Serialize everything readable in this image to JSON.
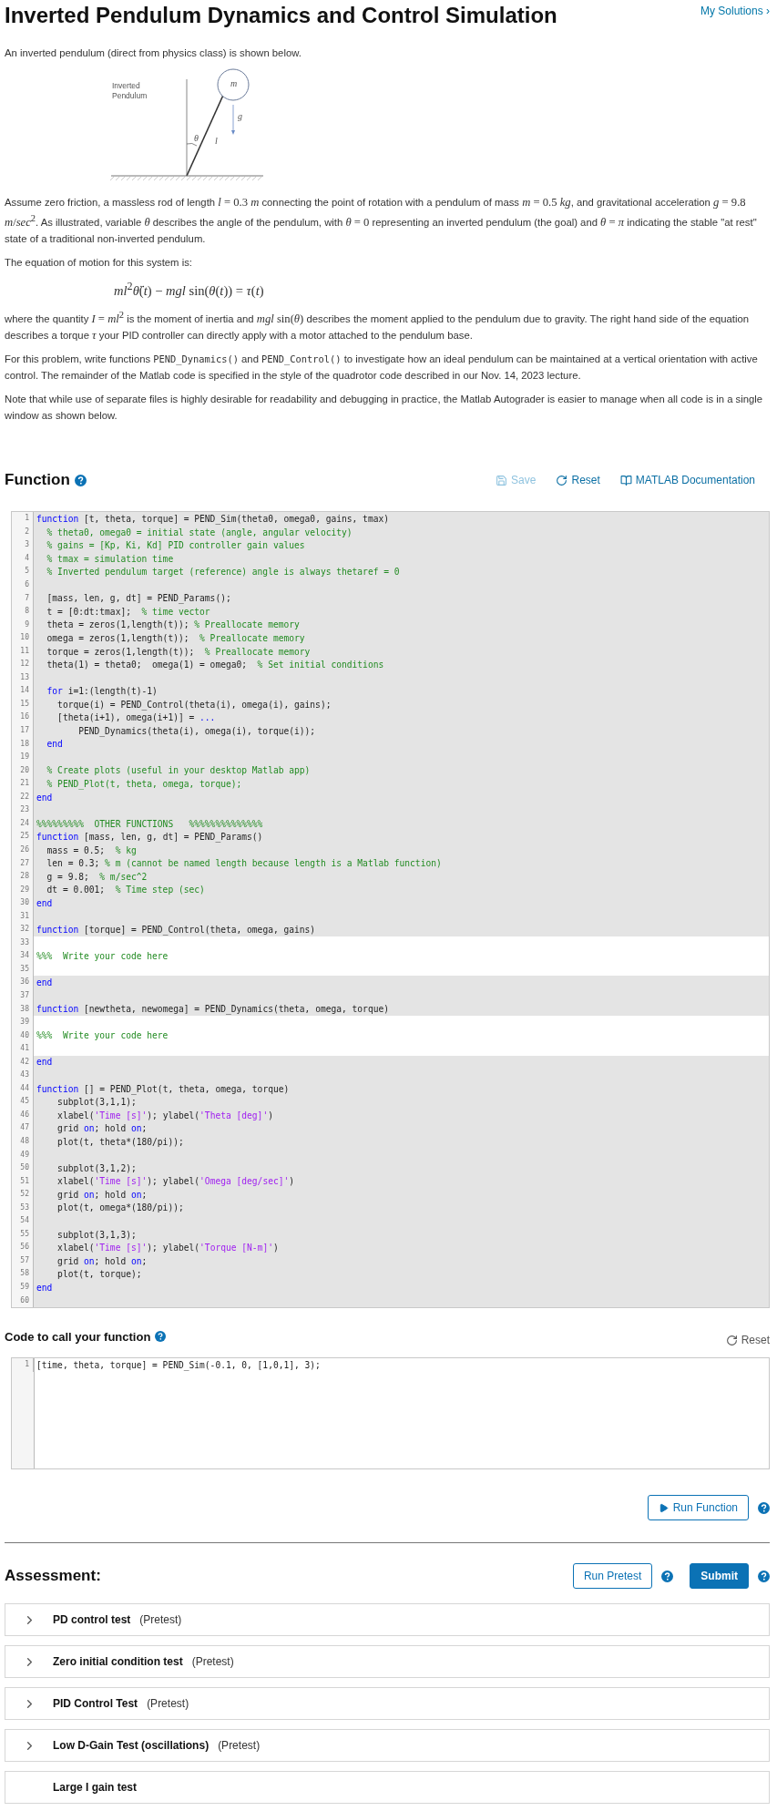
{
  "header": {
    "title": "Inverted Pendulum Dynamics and Control Simulation",
    "link": "My Solutions ›"
  },
  "intro": "An inverted pendulum (direct from physics class) is shown below.",
  "figure": {
    "labels": [
      {
        "kind": "caption",
        "text": "Inverted Pendulum"
      },
      {
        "kind": "mass",
        "text": "m"
      },
      {
        "kind": "gravity",
        "text": "g"
      },
      {
        "kind": "angle",
        "text": "θ"
      },
      {
        "kind": "length",
        "text": "l"
      }
    ]
  },
  "paragraphs": [
    {
      "kind": "text",
      "parts": [
        {
          "kind": "text",
          "text": "Assume zero friction, a massless rod of length "
        },
        {
          "kind": "math",
          "text": "*l* = 0.3  *m*"
        },
        {
          "kind": "text",
          "text": " connecting the point of rotation with a pendulum of mass "
        },
        {
          "kind": "math",
          "text": "*m* = 0.5  *kg*"
        },
        {
          "kind": "text",
          "text": ", and gravitational acceleration "
        },
        {
          "kind": "math",
          "text": "*g* = 9.8  *m*/*sec*$^{2}$"
        },
        {
          "kind": "text",
          "text": ".  As illustrated, variable "
        },
        {
          "kind": "math",
          "text": "*θ*"
        },
        {
          "kind": "text",
          "text": " describes the angle of the pendulum, with "
        },
        {
          "kind": "math",
          "text": "*θ* = 0"
        },
        {
          "kind": "text",
          "text": " representing an inverted pendulum (the goal) and "
        },
        {
          "kind": "math",
          "text": "*θ* = *π*"
        },
        {
          "kind": "text",
          "text": " indicating the stable \"at rest\" state of a traditional non-inverted pendulum."
        }
      ]
    },
    {
      "kind": "text",
      "parts": [
        {
          "kind": "text",
          "text": "The  equation of motion for this system is:"
        }
      ]
    },
    {
      "kind": "equation",
      "parts": [
        {
          "kind": "math",
          "text": "*ml*$^{2}$*θ̈*(*t*) − *mgl* sin(*θ*(*t*)) = *τ*(*t*)"
        }
      ]
    },
    {
      "kind": "text",
      "parts": [
        {
          "kind": "text",
          "text": "where the quantity "
        },
        {
          "kind": "math",
          "text": "*I* = *ml*$^{2}$"
        },
        {
          "kind": "text",
          "text": " is the moment of inertia and "
        },
        {
          "kind": "math",
          "text": "*mgl* sin(*θ*)"
        },
        {
          "kind": "text",
          "text": " describes the moment applied to the pendulum due to gravity.  The right hand side of the equation describes a torque "
        },
        {
          "kind": "math",
          "text": "*τ*"
        },
        {
          "kind": "text",
          "text": " your PID controller can directly apply with a motor attached to the pendulum base."
        }
      ]
    },
    {
      "kind": "text",
      "parts": [
        {
          "kind": "text",
          "text": "For this problem, write functions "
        },
        {
          "kind": "code",
          "text": "PEND_Dynamics()"
        },
        {
          "kind": "text",
          "text": " and "
        },
        {
          "kind": "code",
          "text": "PEND_Control()"
        },
        {
          "kind": "text",
          "text": " to investigate how an ideal pendulum can be maintained at a vertical orientation with active control.  The remainder of the Matlab code is specified in the style of the quadrotor code described in our Nov. 14, 2023 lecture."
        }
      ]
    },
    {
      "kind": "text",
      "parts": [
        {
          "kind": "text",
          "text": "Note that while use of separate files is highly desirable for readability and debugging in practice, the Matlab Autograder is easier to manage when all code is in a single window as shown below."
        }
      ]
    }
  ],
  "function_section": {
    "title": "Function",
    "actions": [
      {
        "kind": "save",
        "label": "Save",
        "disabled": true
      },
      {
        "kind": "reset",
        "label": "Reset",
        "disabled": false
      },
      {
        "kind": "docs",
        "label": "MATLAB Documentation",
        "disabled": false
      }
    ],
    "code": [
      {
        "number": "1",
        "editable": false,
        "segments": [
          {
            "kind": "keyword",
            "text": "function"
          },
          {
            "kind": "plain",
            "text": " [t, theta, torque] = PEND_Sim(theta0, omega0, gains, tmax)"
          }
        ]
      },
      {
        "number": "2",
        "editable": false,
        "segments": [
          {
            "kind": "comment",
            "text": "  % theta0, omega0 = initial state (angle, angular velocity)"
          }
        ]
      },
      {
        "number": "3",
        "editable": false,
        "segments": [
          {
            "kind": "comment",
            "text": "  % gains = [Kp, Ki, Kd] PID controller gain values"
          }
        ]
      },
      {
        "number": "4",
        "editable": false,
        "segments": [
          {
            "kind": "comment",
            "text": "  % tmax = simulation time"
          }
        ]
      },
      {
        "number": "5",
        "editable": false,
        "segments": [
          {
            "kind": "comment",
            "text": "  % Inverted pendulum target (reference) angle is always thetaref = 0"
          }
        ]
      },
      {
        "number": "6",
        "editable": false
      },
      {
        "number": "7",
        "editable": false,
        "segments": [
          {
            "kind": "plain",
            "text": "  [mass, len, g, dt] = PEND_Params();"
          }
        ]
      },
      {
        "number": "8",
        "editable": false,
        "segments": [
          {
            "kind": "plain",
            "text": "  t = [0:dt:tmax];  "
          },
          {
            "kind": "comment",
            "text": "% time vector"
          }
        ]
      },
      {
        "number": "9",
        "editable": false,
        "segments": [
          {
            "kind": "plain",
            "text": "  theta = zeros(1,length(t)); "
          },
          {
            "kind": "comment",
            "text": "% Preallocate memory"
          }
        ]
      },
      {
        "number": "10",
        "editable": false,
        "segments": [
          {
            "kind": "plain",
            "text": "  omega = zeros(1,length(t));  "
          },
          {
            "kind": "comment",
            "text": "% Preallocate memory"
          }
        ]
      },
      {
        "number": "11",
        "editable": false,
        "segments": [
          {
            "kind": "plain",
            "text": "  torque = zeros(1,length(t));  "
          },
          {
            "kind": "comment",
            "text": "% Preallocate memory"
          }
        ]
      },
      {
        "number": "12",
        "editable": false,
        "segments": [
          {
            "kind": "plain",
            "text": "  theta(1) = theta0;  omega(1) = omega0;  "
          },
          {
            "kind": "comment",
            "text": "% Set initial conditions"
          }
        ]
      },
      {
        "number": "13",
        "editable": false
      },
      {
        "number": "14",
        "editable": false,
        "segments": [
          {
            "kind": "keyword",
            "text": "  for"
          },
          {
            "kind": "plain",
            "text": " i=1:(length(t)-1)"
          }
        ]
      },
      {
        "number": "15",
        "editable": false,
        "segments": [
          {
            "kind": "plain",
            "text": "    torque(i) = PEND_Control(theta(i), omega(i), gains);"
          }
        ]
      },
      {
        "number": "16",
        "editable": false,
        "segments": [
          {
            "kind": "plain",
            "text": "    [theta(i+1), omega(i+1)] = "
          },
          {
            "kind": "keyword",
            "text": "..."
          }
        ]
      },
      {
        "number": "17",
        "editable": false,
        "segments": [
          {
            "kind": "plain",
            "text": "        PEND_Dynamics(theta(i), omega(i), torque(i));"
          }
        ]
      },
      {
        "number": "18",
        "editable": false,
        "segments": [
          {
            "kind": "keyword",
            "text": "  end"
          }
        ]
      },
      {
        "number": "19",
        "editable": false
      },
      {
        "number": "20",
        "editable": false,
        "segments": [
          {
            "kind": "comment",
            "text": "  % Create plots (useful in your desktop Matlab app)"
          }
        ]
      },
      {
        "number": "21",
        "editable": false,
        "segments": [
          {
            "kind": "comment",
            "text": "  % PEND_Plot(t, theta, omega, torque);"
          }
        ]
      },
      {
        "number": "22",
        "editable": false,
        "segments": [
          {
            "kind": "keyword",
            "text": "end"
          }
        ]
      },
      {
        "number": "23",
        "editable": false
      },
      {
        "number": "24",
        "editable": false,
        "segments": [
          {
            "kind": "comment",
            "text": "%%%%%%%%%  OTHER FUNCTIONS   %%%%%%%%%%%%%%"
          }
        ]
      },
      {
        "number": "25",
        "editable": false,
        "segments": [
          {
            "kind": "keyword",
            "text": "function"
          },
          {
            "kind": "plain",
            "text": " [mass, len, g, dt] = PEND_Params()"
          }
        ]
      },
      {
        "number": "26",
        "editable": false,
        "segments": [
          {
            "kind": "plain",
            "text": "  mass = 0.5;  "
          },
          {
            "kind": "comment",
            "text": "% kg"
          }
        ]
      },
      {
        "number": "27",
        "editable": false,
        "segments": [
          {
            "kind": "plain",
            "text": "  len = 0.3; "
          },
          {
            "kind": "comment",
            "text": "% m (cannot be named length because length is a Matlab function)"
          }
        ]
      },
      {
        "number": "28",
        "editable": false,
        "segments": [
          {
            "kind": "plain",
            "text": "  g = 9.8;  "
          },
          {
            "kind": "comment",
            "text": "% m/sec^2"
          }
        ]
      },
      {
        "number": "29",
        "editable": false,
        "segments": [
          {
            "kind": "plain",
            "text": "  dt = 0.001;  "
          },
          {
            "kind": "comment",
            "text": "% Time step (sec)"
          }
        ]
      },
      {
        "number": "30",
        "editable": false,
        "segments": [
          {
            "kind": "keyword",
            "text": "end"
          }
        ]
      },
      {
        "number": "31",
        "editable": false
      },
      {
        "number": "32",
        "editable": false,
        "segments": [
          {
            "kind": "keyword",
            "text": "function"
          },
          {
            "kind": "plain",
            "text": " [torque] = PEND_Control(theta, omega, gains)"
          }
        ]
      },
      {
        "number": "33",
        "editable": true
      },
      {
        "number": "34",
        "editable": true,
        "segments": [
          {
            "kind": "comment",
            "text": "%%%  Write your code here"
          }
        ]
      },
      {
        "number": "35",
        "editable": true
      },
      {
        "number": "36",
        "editable": false,
        "segments": [
          {
            "kind": "keyword",
            "text": "end"
          }
        ]
      },
      {
        "number": "37",
        "editable": false
      },
      {
        "number": "38",
        "editable": false,
        "segments": [
          {
            "kind": "keyword",
            "text": "function"
          },
          {
            "kind": "plain",
            "text": " [newtheta, newomega] = PEND_Dynamics(theta, omega, torque)"
          }
        ]
      },
      {
        "number": "39",
        "editable": true
      },
      {
        "number": "40",
        "editable": true,
        "segments": [
          {
            "kind": "comment",
            "text": "%%%  Write your code here"
          }
        ]
      },
      {
        "number": "41",
        "editable": true
      },
      {
        "number": "42",
        "editable": false,
        "segments": [
          {
            "kind": "keyword",
            "text": "end"
          }
        ]
      },
      {
        "number": "43",
        "editable": false
      },
      {
        "number": "44",
        "editable": false,
        "segments": [
          {
            "kind": "keyword",
            "text": "function"
          },
          {
            "kind": "plain",
            "text": " [] = PEND_Plot(t, theta, omega, torque)"
          }
        ]
      },
      {
        "number": "45",
        "editable": false,
        "segments": [
          {
            "kind": "plain",
            "text": "    subplot(3,1,1);"
          }
        ]
      },
      {
        "number": "46",
        "editable": false,
        "segments": [
          {
            "kind": "plain",
            "text": "    xlabel("
          },
          {
            "kind": "string",
            "text": "'Time [s]'"
          },
          {
            "kind": "plain",
            "text": "); ylabel("
          },
          {
            "kind": "string",
            "text": "'Theta [deg]'"
          },
          {
            "kind": "plain",
            "text": ")"
          }
        ]
      },
      {
        "number": "47",
        "editable": false,
        "segments": [
          {
            "kind": "plain",
            "text": "    grid "
          },
          {
            "kind": "keyword",
            "text": "on"
          },
          {
            "kind": "plain",
            "text": "; hold "
          },
          {
            "kind": "keyword",
            "text": "on"
          },
          {
            "kind": "plain",
            "text": ";"
          }
        ]
      },
      {
        "number": "48",
        "editable": false,
        "segments": [
          {
            "kind": "plain",
            "text": "    plot(t, theta*(180/pi));"
          }
        ]
      },
      {
        "number": "49",
        "editable": false
      },
      {
        "number": "50",
        "editable": false,
        "segments": [
          {
            "kind": "plain",
            "text": "    subplot(3,1,2);"
          }
        ]
      },
      {
        "number": "51",
        "editable": false,
        "segments": [
          {
            "kind": "plain",
            "text": "    xlabel("
          },
          {
            "kind": "string",
            "text": "'Time [s]'"
          },
          {
            "kind": "plain",
            "text": "); ylabel("
          },
          {
            "kind": "string",
            "text": "'Omega [deg/sec]'"
          },
          {
            "kind": "plain",
            "text": ")"
          }
        ]
      },
      {
        "number": "52",
        "editable": false,
        "segments": [
          {
            "kind": "plain",
            "text": "    grid "
          },
          {
            "kind": "keyword",
            "text": "on"
          },
          {
            "kind": "plain",
            "text": "; hold "
          },
          {
            "kind": "keyword",
            "text": "on"
          },
          {
            "kind": "plain",
            "text": ";"
          }
        ]
      },
      {
        "number": "53",
        "editable": false,
        "segments": [
          {
            "kind": "plain",
            "text": "    plot(t, omega*(180/pi));"
          }
        ]
      },
      {
        "number": "54",
        "editable": false
      },
      {
        "number": "55",
        "editable": false,
        "segments": [
          {
            "kind": "plain",
            "text": "    subplot(3,1,3);"
          }
        ]
      },
      {
        "number": "56",
        "editable": false,
        "segments": [
          {
            "kind": "plain",
            "text": "    xlabel("
          },
          {
            "kind": "string",
            "text": "'Time [s]'"
          },
          {
            "kind": "plain",
            "text": "); ylabel("
          },
          {
            "kind": "string",
            "text": "'Torque [N-m]'"
          },
          {
            "kind": "plain",
            "text": ")"
          }
        ]
      },
      {
        "number": "57",
        "editable": false,
        "segments": [
          {
            "kind": "plain",
            "text": "    grid "
          },
          {
            "kind": "keyword",
            "text": "on"
          },
          {
            "kind": "plain",
            "text": "; hold "
          },
          {
            "kind": "keyword",
            "text": "on"
          },
          {
            "kind": "plain",
            "text": ";"
          }
        ]
      },
      {
        "number": "58",
        "editable": false,
        "segments": [
          {
            "kind": "plain",
            "text": "    plot(t, torque);"
          }
        ]
      },
      {
        "number": "59",
        "editable": false,
        "segments": [
          {
            "kind": "keyword",
            "text": "end"
          }
        ]
      },
      {
        "number": "60",
        "editable": false
      }
    ]
  },
  "call_section": {
    "title": "Code to call your function",
    "reset": "Reset",
    "code": [
      {
        "number": "1",
        "segments": [
          {
            "kind": "plain",
            "text": "[time, theta, torque] = PEND_Sim(-0.1, 0, [1,0,1], 3);"
          }
        ]
      }
    ],
    "run_button": "Run Function"
  },
  "assessment": {
    "title": "Assessment:",
    "buttons": [
      {
        "kind": "outline",
        "label": "Run Pretest"
      },
      {
        "kind": "primary",
        "label": "Submit"
      }
    ],
    "tests": [
      {
        "name": "PD control test",
        "tag": "(Pretest)",
        "expandable": true
      },
      {
        "name": "Zero initial condition test",
        "tag": "(Pretest)",
        "expandable": true
      },
      {
        "name": "PID Control Test",
        "tag": "(Pretest)",
        "expandable": true
      },
      {
        "name": "Low D-Gain Test (oscillations)",
        "tag": "(Pretest)",
        "expandable": true
      },
      {
        "name": "Large I gain test",
        "expandable": false
      }
    ]
  }
}
